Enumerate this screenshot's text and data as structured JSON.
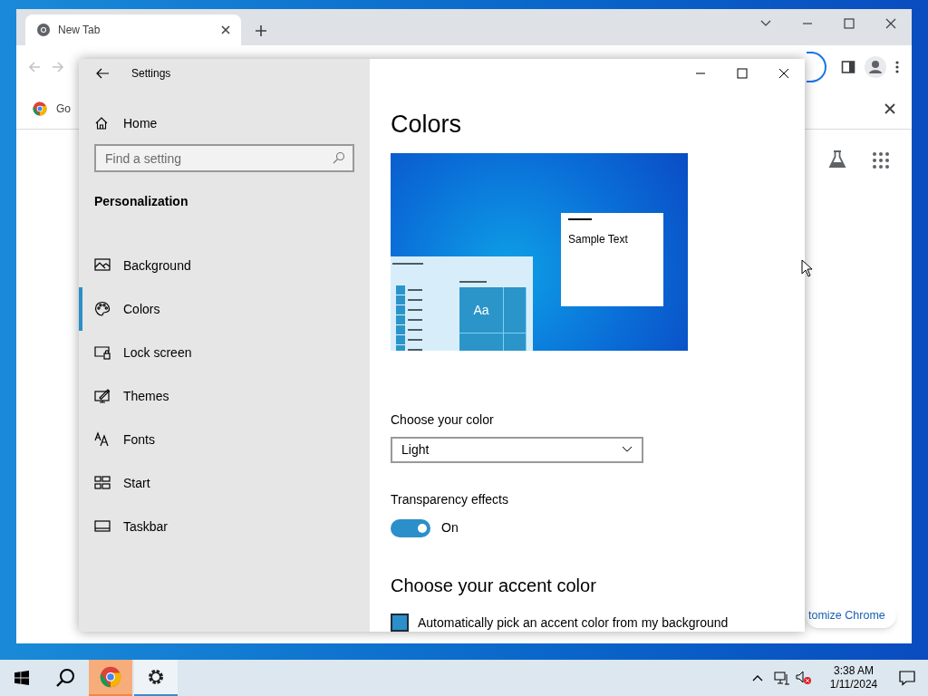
{
  "browser": {
    "tabs": [
      {
        "title": "New Tab",
        "selected": true
      }
    ],
    "bookmarks": [
      {
        "label": "Go"
      }
    ],
    "customize_button": "tomize Chrome"
  },
  "settings": {
    "title": "Settings",
    "home": "Home",
    "search": {
      "placeholder": "Find a setting"
    },
    "section": "Personalization",
    "nav": [
      {
        "label": "Background",
        "kind": "background",
        "selected": false
      },
      {
        "label": "Colors",
        "kind": "colors",
        "selected": true
      },
      {
        "label": "Lock screen",
        "kind": "lock",
        "selected": false
      },
      {
        "label": "Themes",
        "kind": "themes",
        "selected": false
      },
      {
        "label": "Fonts",
        "kind": "fonts",
        "selected": false
      },
      {
        "label": "Start",
        "kind": "start",
        "selected": false
      },
      {
        "label": "Taskbar",
        "kind": "taskbar",
        "selected": false
      }
    ],
    "page_title": "Colors",
    "preview": {
      "sample_text": "Sample Text",
      "tile_text": "Aa"
    },
    "color_mode": {
      "label": "Choose your color",
      "value": "Light"
    },
    "transparency": {
      "label": "Transparency effects",
      "on": true,
      "state_text": "On"
    },
    "accent_heading": "Choose your accent color",
    "auto_accent": {
      "label": "Automatically pick an accent color from my background",
      "checked": true
    }
  },
  "taskbar": {
    "apps": [
      {
        "kind": "chrome",
        "attention": true,
        "selected": false
      },
      {
        "kind": "settings",
        "attention": false,
        "selected": true
      }
    ],
    "time": "3:38 AM",
    "date": "1/11/2024"
  }
}
